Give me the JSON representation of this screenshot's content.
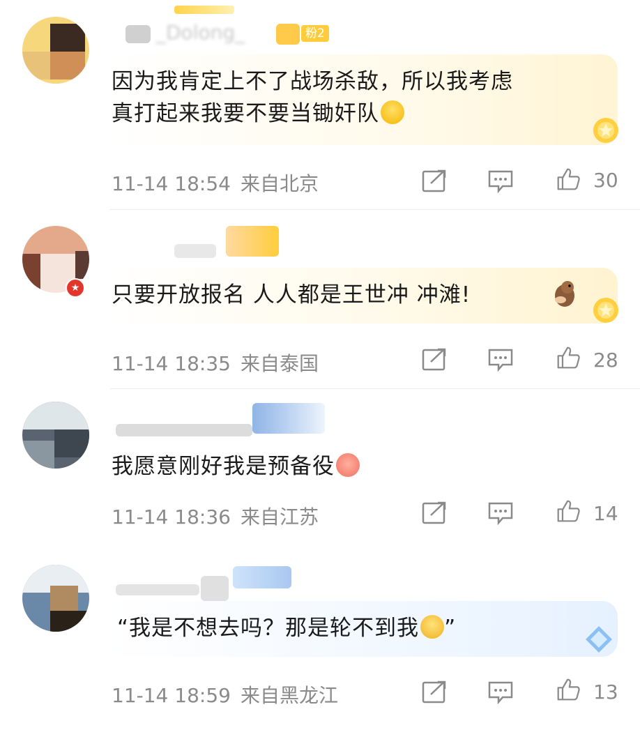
{
  "comments": [
    {
      "username": "_Dolong_",
      "fan_badge": "粉2",
      "text_lines": [
        "因为我肯定上不了战场杀敌，所以我考虑",
        "真打起来我要不要当锄奸队"
      ],
      "emoji": "cry-laugh-emoji",
      "time": "11-14 18:54",
      "location": "来自北京",
      "likes": "30"
    },
    {
      "username": "",
      "fan_badge": "",
      "text_lines": [
        "只要开放报名 人人都是王世冲 冲滩!"
      ],
      "emoji": "otter-emoji",
      "time": "11-14 18:35",
      "location": "来自泰国",
      "likes": "28"
    },
    {
      "username": "",
      "fan_badge": "",
      "text_lines": [
        "我愿意刚好我是预备役"
      ],
      "emoji": "poop-emoji",
      "time": "11-14 18:36",
      "location": "来自江苏",
      "likes": "14"
    },
    {
      "username": "",
      "fan_badge": "",
      "text_lines": [
        "“我是不想去吗？那是轮不到我"
      ],
      "text_tail": "”",
      "emoji": "crying-emoji",
      "time": "11-14 18:59",
      "location": "来自黑龙江",
      "likes": "13"
    }
  ],
  "icons": [
    "repost-icon",
    "comment-icon",
    "like-icon"
  ],
  "colors": {
    "meta_text": "#8a8a8a",
    "body_text": "#1a1a1a",
    "bubble_gold": "#fff8e1",
    "bubble_blue": "#eef6ff"
  }
}
